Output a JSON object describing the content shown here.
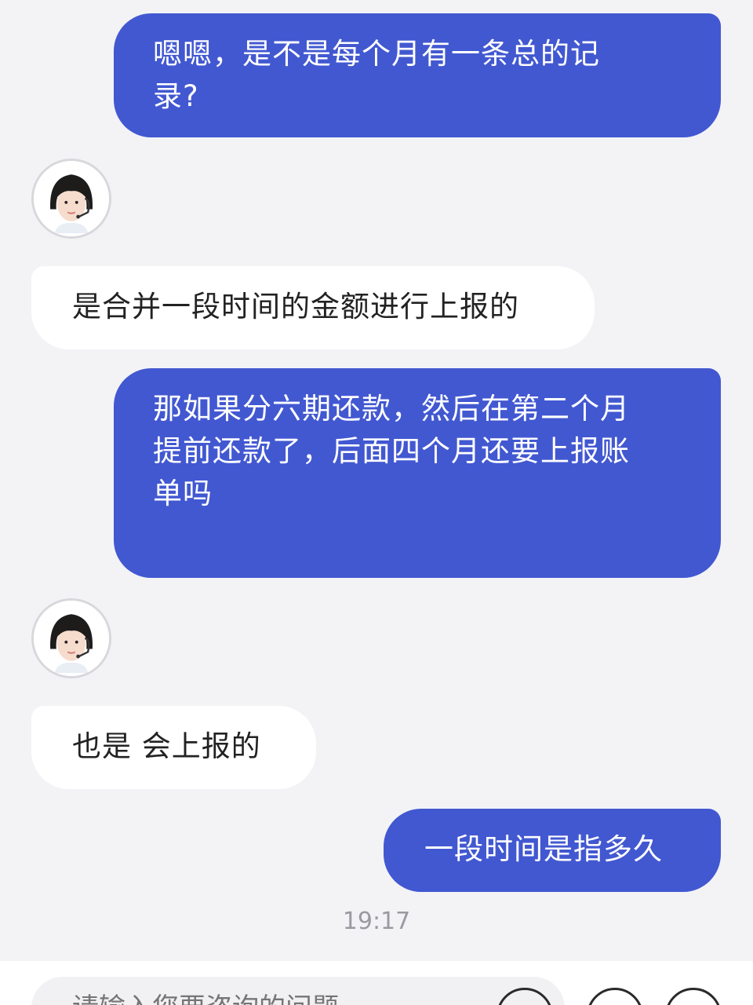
{
  "messages": [
    {
      "side": "out",
      "text_lines": [
        "嗯嗯，是不是每个月有一条总的记",
        "录?"
      ]
    },
    {
      "side": "in",
      "text": "是合并一段时间的金额进行上报的"
    },
    {
      "side": "out",
      "text_lines": [
        "那如果分六期还款，然后在第二个月",
        "提前还款了，后面四个月还要上报账",
        "单吗"
      ]
    },
    {
      "side": "in",
      "text": "也是 会上报的"
    },
    {
      "side": "out",
      "text": "一段时间是指多久"
    }
  ],
  "timestamp": "19:17",
  "input": {
    "placeholder": "请输入您要咨询的问题"
  },
  "colors": {
    "outgoing_bubble": "#4258d1",
    "incoming_bubble": "#ffffff",
    "background": "#f3f3f6"
  },
  "icons": {
    "agent_avatar": "agent-avatar-headset",
    "input_buttons": [
      "emoji-icon",
      "voice-icon",
      "add-icon"
    ]
  }
}
